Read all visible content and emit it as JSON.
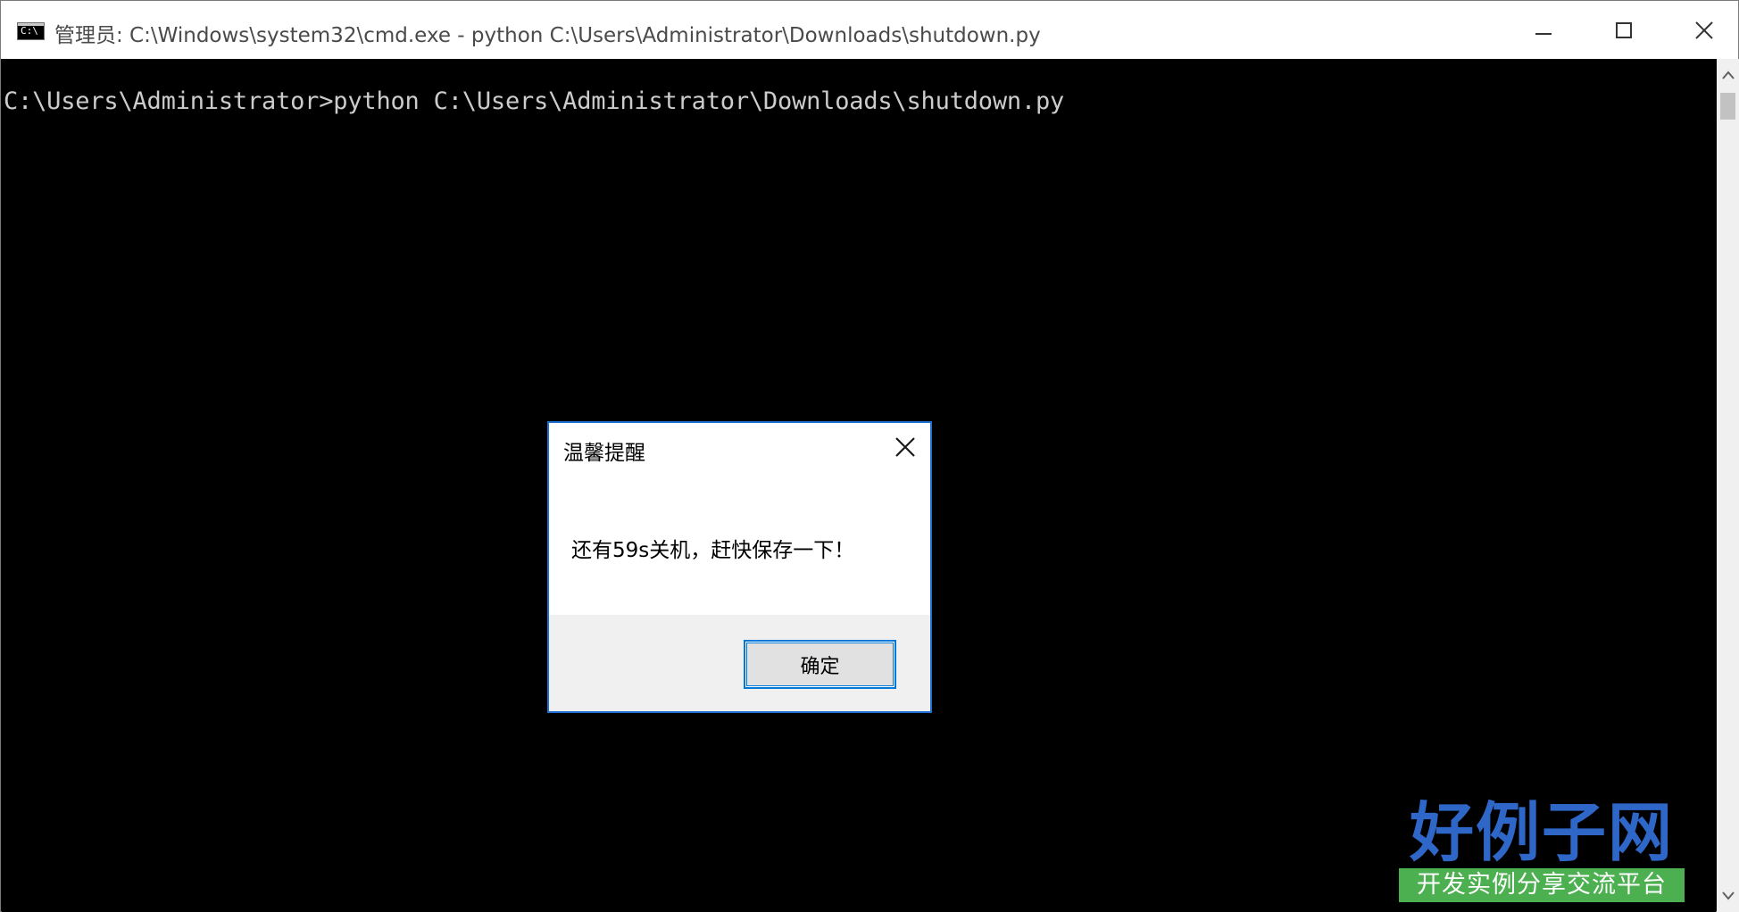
{
  "window": {
    "title": "管理员: C:\\Windows\\system32\\cmd.exe - python  C:\\Users\\Administrator\\Downloads\\shutdown.py",
    "icon": "C:\\"
  },
  "console": {
    "lines": [
      "C:\\Users\\Administrator>python C:\\Users\\Administrator\\Downloads\\shutdown.py"
    ]
  },
  "dialog": {
    "title": "温馨提醒",
    "message": "还有59s关机，赶快保存一下！",
    "ok_label": "确定"
  },
  "watermark": {
    "main": "好例子网",
    "sub": "开发实例分享交流平台"
  },
  "colors": {
    "console_bg": "#000000",
    "console_fg": "#cccccc",
    "dialog_border": "#1f6fd1",
    "button_focus": "#0078d7",
    "watermark_blue": "#2e67c7",
    "watermark_green": "#4caf50"
  }
}
